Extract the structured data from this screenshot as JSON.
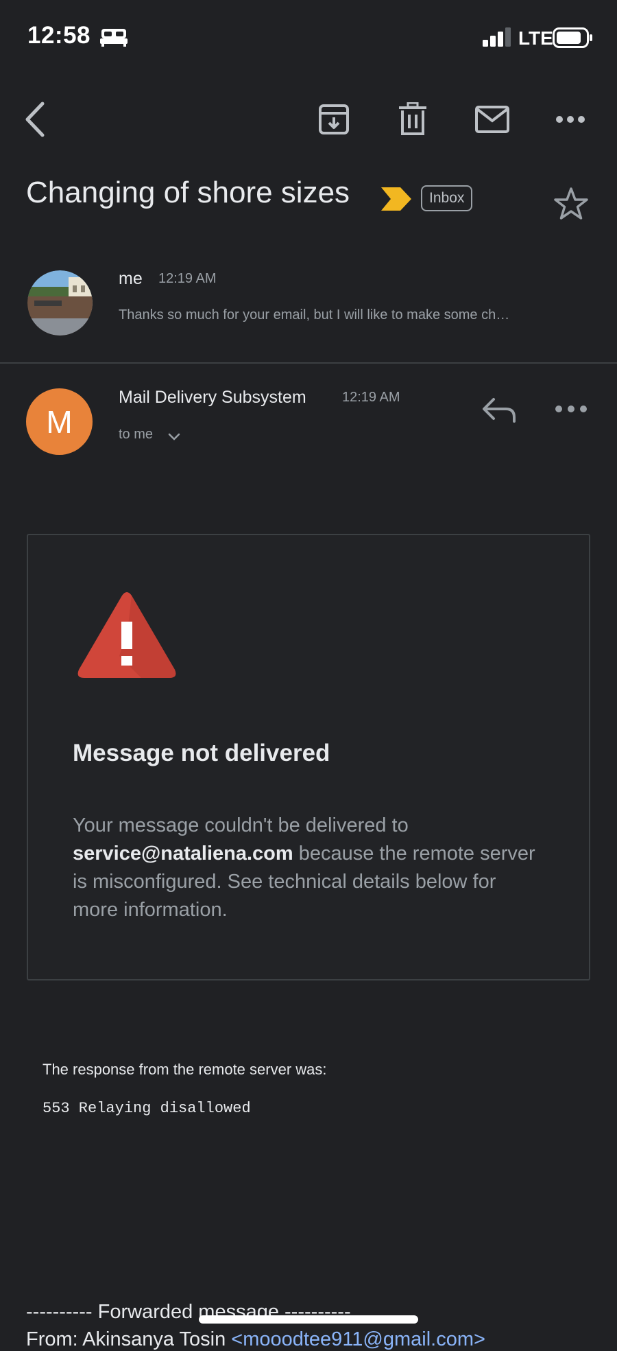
{
  "status_bar": {
    "time": "12:58",
    "network": "LTE"
  },
  "icons": {
    "back": "back-arrow-icon",
    "archive": "archive-icon",
    "delete": "trash-icon",
    "mark_unread": "mail-icon",
    "more": "more-horizontal-icon",
    "important": "important-label-icon",
    "star": "star-icon",
    "reply": "reply-icon",
    "warning": "warning-triangle-icon"
  },
  "colors": {
    "background": "#202124",
    "avatar_m": "#e8833a",
    "important_marker": "#f2b721",
    "warning_red": "#d0463a",
    "link": "#8ab4f8"
  },
  "thread": {
    "subject": "Changing of shore sizes",
    "label": "Inbox"
  },
  "message1": {
    "sender": "me",
    "time": "12:19 AM",
    "snippet": "Thanks so much for your email, but I will like to make some ch…"
  },
  "message2": {
    "avatar_letter": "M",
    "sender": "Mail Delivery Subsystem",
    "time": "12:19 AM",
    "recipient": "to me"
  },
  "bounce": {
    "title": "Message not delivered",
    "body_prefix": "Your message couldn't be delivered to ",
    "address": "service@nataliena.com",
    "body_suffix": " because the remote server is misconfigured. See technical details below for more information.",
    "response_label": "The response from the remote server was:",
    "response_code": "553 Relaying disallowed"
  },
  "forwarded": {
    "header": "---------- Forwarded message ----------",
    "from_prefix": "From: Akinsanya Tosin ",
    "from_email": "<mooodtee911@gmail.com>"
  }
}
